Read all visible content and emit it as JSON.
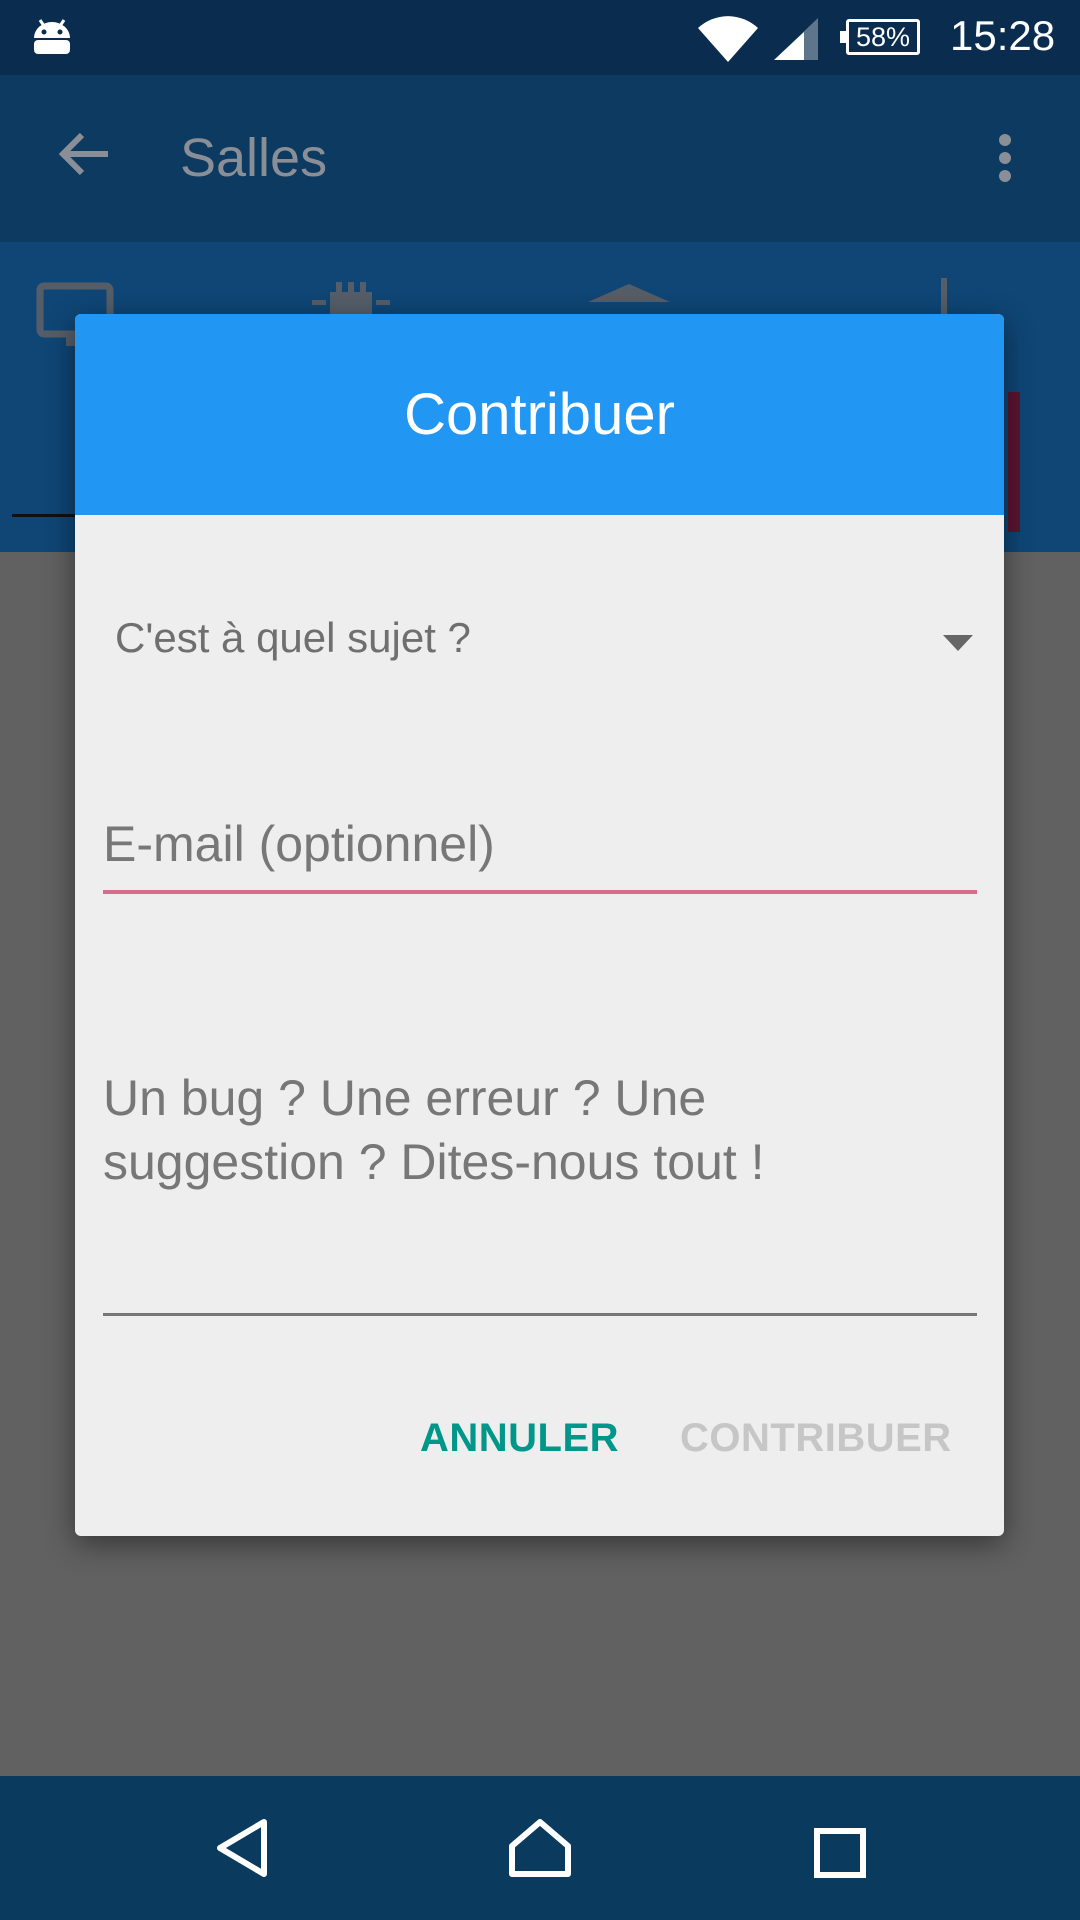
{
  "status_bar": {
    "battery": "58%",
    "time": "15:28",
    "icons": [
      "android-icon",
      "wifi-icon",
      "signal-icon",
      "battery-icon"
    ]
  },
  "app_bar": {
    "title": "Salles",
    "icons": [
      "back-arrow-icon",
      "more-vert-icon"
    ]
  },
  "tabs": {
    "icons": [
      "monitor-icon",
      "chip-icon",
      "graduation-cap-icon",
      "download-icon"
    ]
  },
  "dialog": {
    "title": "Contribuer",
    "subject_spinner": "C'est à quel sujet ?",
    "email_placeholder": "E-mail (optionnel)",
    "message_placeholder": "Un bug ? Une erreur ? Une suggestion ? Dites-nous tout !",
    "cancel_label": "ANNULER",
    "submit_label": "CONTRIBUER"
  },
  "colors": {
    "header": "#2196f3",
    "cancel": "#00968a",
    "submit_disabled": "#c6c6c6",
    "email_underline": "#d66b8e"
  },
  "nav_bar": {
    "icons": [
      "back-triangle-icon",
      "home-icon",
      "recents-icon"
    ]
  }
}
